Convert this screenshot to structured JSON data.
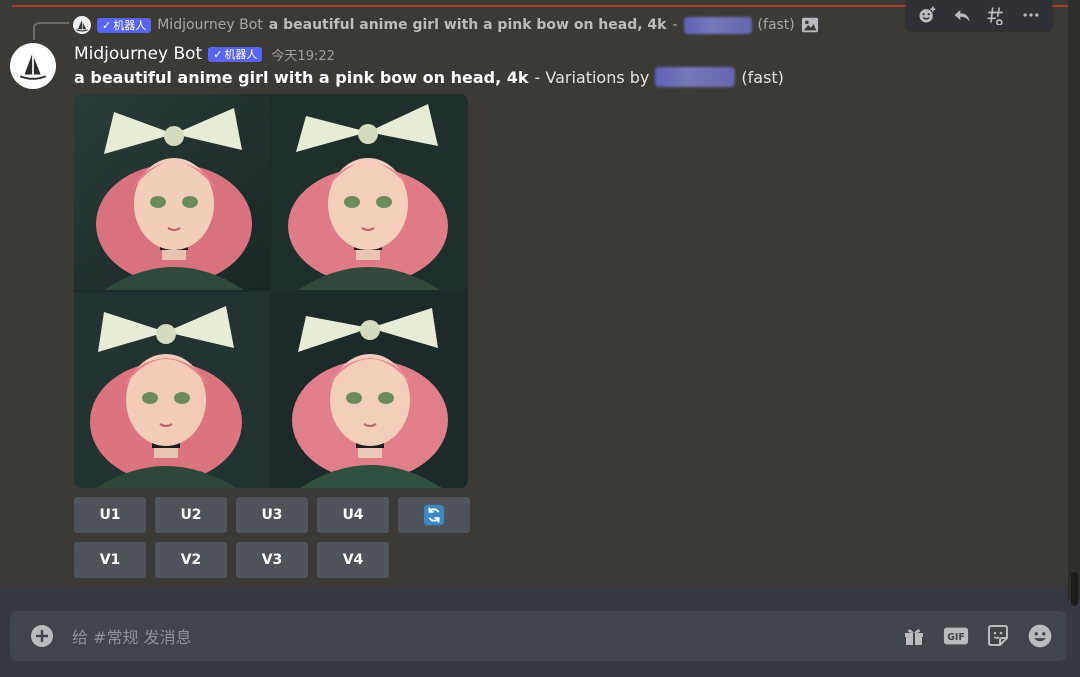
{
  "reply": {
    "bot_name": "Midjourney Bot",
    "badge": "机器人",
    "prompt": "a beautiful anime girl with a pink bow on head, 4k",
    "separator": "-",
    "speed": "(fast)"
  },
  "message": {
    "username": "Midjourney Bot",
    "badge": "机器人",
    "timestamp": "今天19:22",
    "prompt": "a beautiful anime girl with a pink bow on head, 4k",
    "suffix": "- Variations by",
    "speed": "(fast)"
  },
  "buttons": {
    "u1": "U1",
    "u2": "U2",
    "u3": "U3",
    "u4": "U4",
    "v1": "V1",
    "v2": "V2",
    "v3": "V3",
    "v4": "V4"
  },
  "composer": {
    "placeholder": "给 #常规 发消息"
  },
  "icons": {
    "toolbar": [
      "add-reaction-icon",
      "reply-icon",
      "create-thread-icon",
      "more-icon"
    ],
    "composer": [
      "gift-icon",
      "gif-icon",
      "sticker-icon",
      "emoji-icon"
    ],
    "reroll": "refresh-icon"
  },
  "colors": {
    "background": "#3c3a36",
    "badge": "#5865f2",
    "button": "#4f545c",
    "composer": "#40444b",
    "accent_top_line": "#c0392b"
  }
}
